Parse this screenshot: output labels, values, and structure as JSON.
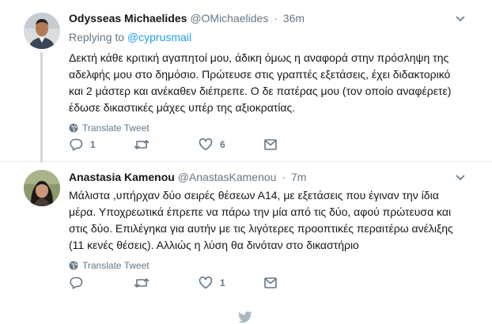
{
  "tweets": [
    {
      "name": "Odysseas Michaelides",
      "handle": "@OMichaelides",
      "time": "36m",
      "replying_label": "Replying to",
      "replying_to": "@cyprusmail",
      "text_lines": [
        "Δεκτή κάθε κριτική αγαπητοί μου, άδικη όμως η αναφορά στην πρόσληψη της",
        "αδελφής μου στο δημόσιο. Πρώτευσε στις γραπτές εξετάσεις, έχει διδακτορικό",
        "και 2 μάστερ και ανέκαθεν διέπρεπε. Ο δε πατέρας μου (τον οποίο αναφέρετε)",
        "έδωσε δικαστικές μάχες υπέρ της αξιοκρατίας."
      ],
      "translate": "Translate Tweet",
      "reply_count": "1",
      "retweet_count": "",
      "like_count": "6"
    },
    {
      "name": "Anastasia Kamenou",
      "handle": "@AnastasKamenou",
      "time": "7m",
      "text_lines": [
        "Μάλιστα ,υπήρχαν δύο σειρές θέσεων Α14, με εξετάσεις που έγιναν την ίδια",
        "μέρα. Υποχρεωτικά έπρεπε να πάρω την μία από τις δύο, αφού πρώτευσα και",
        "στις δύο. Επιλέγηκα για αυτήν με τις λιγότερες προοπτικές περαιτέρω ανέλιξης",
        "(11 κενές θέσεις). Αλλιώς η λύση θα δινόταν στο δικαστήριο"
      ],
      "translate": "Translate Tweet",
      "reply_count": "",
      "retweet_count": "",
      "like_count": "1"
    }
  ],
  "colors": {
    "text": "#14171a",
    "secondary": "#657786",
    "link": "#1da1f2",
    "border": "#e6ecf0",
    "thread": "#ccd6dd"
  },
  "icons": [
    "chevron-down-icon",
    "globe-icon",
    "reply-icon",
    "retweet-icon",
    "like-icon",
    "dm-icon",
    "twitter-bird-icon"
  ]
}
